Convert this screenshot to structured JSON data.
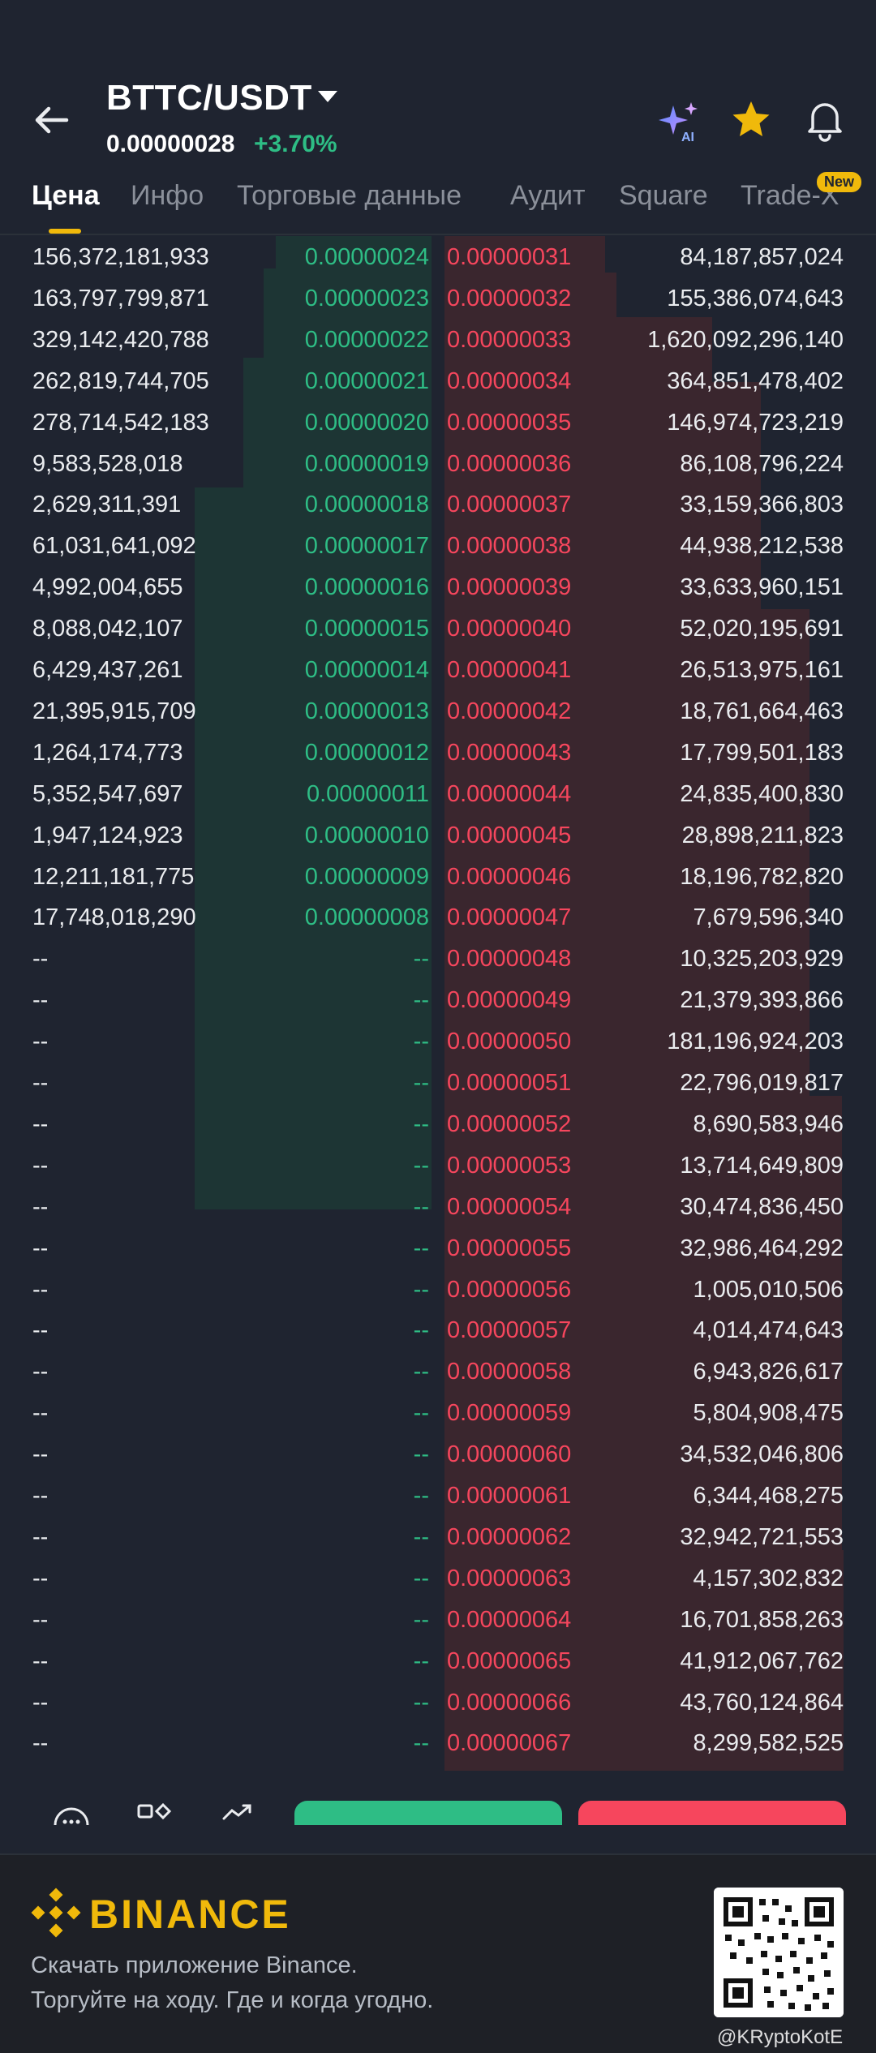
{
  "header": {
    "pair": "BTTC/USDT",
    "price": "0.00000028",
    "change": "+3.70%"
  },
  "tabs": [
    {
      "label": "Цена"
    },
    {
      "label": "Инфо"
    },
    {
      "label": "Торговые данные"
    },
    {
      "label": "Аудит"
    },
    {
      "label": "Square"
    },
    {
      "label": "Trade-X"
    }
  ],
  "new_badge": "New",
  "colors": {
    "buy": "#2ebd85",
    "sell": "#f6465d",
    "brand": "#f0b90b",
    "background": "#1f2430"
  },
  "order_book": {
    "rows": [
      {
        "bid_amount": "156,372,181,933",
        "bid_price": "0.00000024",
        "ask_price": "0.00000031",
        "ask_amount": "84,187,857,024"
      },
      {
        "bid_amount": "163,797,799,871",
        "bid_price": "0.00000023",
        "ask_price": "0.00000032",
        "ask_amount": "155,386,074,643"
      },
      {
        "bid_amount": "329,142,420,788",
        "bid_price": "0.00000022",
        "ask_price": "0.00000033",
        "ask_amount": "1,620,092,296,140"
      },
      {
        "bid_amount": "262,819,744,705",
        "bid_price": "0.00000021",
        "ask_price": "0.00000034",
        "ask_amount": "364,851,478,402"
      },
      {
        "bid_amount": "278,714,542,183",
        "bid_price": "0.00000020",
        "ask_price": "0.00000035",
        "ask_amount": "146,974,723,219"
      },
      {
        "bid_amount": "9,583,528,018",
        "bid_price": "0.00000019",
        "ask_price": "0.00000036",
        "ask_amount": "86,108,796,224"
      },
      {
        "bid_amount": "2,629,311,391",
        "bid_price": "0.00000018",
        "ask_price": "0.00000037",
        "ask_amount": "33,159,366,803"
      },
      {
        "bid_amount": "61,031,641,092",
        "bid_price": "0.00000017",
        "ask_price": "0.00000038",
        "ask_amount": "44,938,212,538"
      },
      {
        "bid_amount": "4,992,004,655",
        "bid_price": "0.00000016",
        "ask_price": "0.00000039",
        "ask_amount": "33,633,960,151"
      },
      {
        "bid_amount": "8,088,042,107",
        "bid_price": "0.00000015",
        "ask_price": "0.00000040",
        "ask_amount": "52,020,195,691"
      },
      {
        "bid_amount": "6,429,437,261",
        "bid_price": "0.00000014",
        "ask_price": "0.00000041",
        "ask_amount": "26,513,975,161"
      },
      {
        "bid_amount": "21,395,915,709",
        "bid_price": "0.00000013",
        "ask_price": "0.00000042",
        "ask_amount": "18,761,664,463"
      },
      {
        "bid_amount": "1,264,174,773",
        "bid_price": "0.00000012",
        "ask_price": "0.00000043",
        "ask_amount": "17,799,501,183"
      },
      {
        "bid_amount": "5,352,547,697",
        "bid_price": "0.00000011",
        "ask_price": "0.00000044",
        "ask_amount": "24,835,400,830"
      },
      {
        "bid_amount": "1,947,124,923",
        "bid_price": "0.00000010",
        "ask_price": "0.00000045",
        "ask_amount": "28,898,211,823"
      },
      {
        "bid_amount": "12,211,181,775",
        "bid_price": "0.00000009",
        "ask_price": "0.00000046",
        "ask_amount": "18,196,782,820"
      },
      {
        "bid_amount": "17,748,018,290",
        "bid_price": "0.00000008",
        "ask_price": "0.00000047",
        "ask_amount": "7,679,596,340"
      },
      {
        "bid_amount": "--",
        "bid_price": "--",
        "ask_price": "0.00000048",
        "ask_amount": "10,325,203,929"
      },
      {
        "bid_amount": "--",
        "bid_price": "--",
        "ask_price": "0.00000049",
        "ask_amount": "21,379,393,866"
      },
      {
        "bid_amount": "--",
        "bid_price": "--",
        "ask_price": "0.00000050",
        "ask_amount": "181,196,924,203"
      },
      {
        "bid_amount": "--",
        "bid_price": "--",
        "ask_price": "0.00000051",
        "ask_amount": "22,796,019,817"
      },
      {
        "bid_amount": "--",
        "bid_price": "--",
        "ask_price": "0.00000052",
        "ask_amount": "8,690,583,946"
      },
      {
        "bid_amount": "--",
        "bid_price": "--",
        "ask_price": "0.00000053",
        "ask_amount": "13,714,649,809"
      },
      {
        "bid_amount": "--",
        "bid_price": "--",
        "ask_price": "0.00000054",
        "ask_amount": "30,474,836,450"
      },
      {
        "bid_amount": "--",
        "bid_price": "--",
        "ask_price": "0.00000055",
        "ask_amount": "32,986,464,292"
      },
      {
        "bid_amount": "--",
        "bid_price": "--",
        "ask_price": "0.00000056",
        "ask_amount": "1,005,010,506"
      },
      {
        "bid_amount": "--",
        "bid_price": "--",
        "ask_price": "0.00000057",
        "ask_amount": "4,014,474,643"
      },
      {
        "bid_amount": "--",
        "bid_price": "--",
        "ask_price": "0.00000058",
        "ask_amount": "6,943,826,617"
      },
      {
        "bid_amount": "--",
        "bid_price": "--",
        "ask_price": "0.00000059",
        "ask_amount": "5,804,908,475"
      },
      {
        "bid_amount": "--",
        "bid_price": "--",
        "ask_price": "0.00000060",
        "ask_amount": "34,532,046,806"
      },
      {
        "bid_amount": "--",
        "bid_price": "--",
        "ask_price": "0.00000061",
        "ask_amount": "6,344,468,275"
      },
      {
        "bid_amount": "--",
        "bid_price": "--",
        "ask_price": "0.00000062",
        "ask_amount": "32,942,721,553"
      },
      {
        "bid_amount": "--",
        "bid_price": "--",
        "ask_price": "0.00000063",
        "ask_amount": "4,157,302,832"
      },
      {
        "bid_amount": "--",
        "bid_price": "--",
        "ask_price": "0.00000064",
        "ask_amount": "16,701,858,263"
      },
      {
        "bid_amount": "--",
        "bid_price": "--",
        "ask_price": "0.00000065",
        "ask_amount": "41,912,067,762"
      },
      {
        "bid_amount": "--",
        "bid_price": "--",
        "ask_price": "0.00000066",
        "ask_amount": "43,760,124,864"
      },
      {
        "bid_amount": "--",
        "bid_price": "--",
        "ask_price": "0.00000067",
        "ask_amount": "8,299,582,525"
      }
    ]
  },
  "footer": {
    "brand": "BINANCE",
    "line1": "Скачать приложение Binance.",
    "line2": "Торгуйте на ходу. Где и когда угодно."
  },
  "watermark": "@KRyptoKotE"
}
